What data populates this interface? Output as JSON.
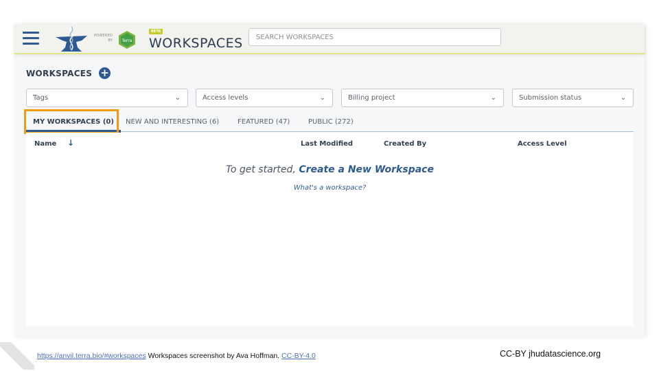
{
  "header": {
    "menu_icon": "hamburger-menu-icon",
    "logo_icon": "anvil-logo-icon",
    "powered_by": "POWERED BY",
    "terra_label": "Terra",
    "beta_badge": "BETA",
    "title": "WORKSPACES",
    "search_placeholder": "SEARCH WORKSPACES",
    "search_value": ""
  },
  "page": {
    "title": "WORKSPACES",
    "add_icon": "plus-circle-icon"
  },
  "filters": [
    {
      "label": "Tags"
    },
    {
      "label": "Access levels"
    },
    {
      "label": "Billing project"
    },
    {
      "label": "Submission status"
    }
  ],
  "tabs": [
    {
      "label": "MY WORKSPACES (0)",
      "active": true
    },
    {
      "label": "NEW AND INTERESTING (6)",
      "active": false
    },
    {
      "label": "FEATURED (47)",
      "active": false
    },
    {
      "label": "PUBLIC (272)",
      "active": false
    }
  ],
  "table": {
    "columns": [
      "Name",
      "Last Modified",
      "Created By",
      "Access Level"
    ],
    "sort_icon": "arrow-down-icon",
    "rows": [],
    "empty_prefix": "To get started, ",
    "empty_link": "Create a New Workspace",
    "help_link": "What's a workspace?"
  },
  "highlight_color": "#f39c12",
  "accent_color": "#2d5a92",
  "footer": {
    "url": "https://anvil.terra.bio/#workspaces",
    "caption": " Workspaces screenshot by Ava Hoffman.  ",
    "license": "CC-BY-4.0",
    "credit": "CC-BY  jhudatascience.org"
  }
}
